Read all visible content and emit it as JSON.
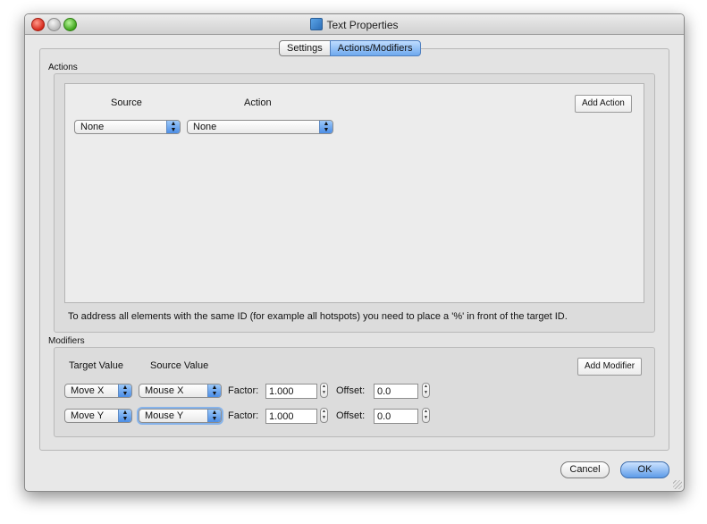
{
  "window": {
    "title": "Text Properties",
    "title_icon": "text-properties-app-icon"
  },
  "tabs": [
    {
      "label": "Settings",
      "active": false
    },
    {
      "label": "Actions/Modifiers",
      "active": true
    }
  ],
  "actions": {
    "group_label": "Actions",
    "source_header": "Source",
    "action_header": "Action",
    "add_button": "Add Action",
    "row": {
      "source": "None",
      "action": "None"
    },
    "hint": "To address all elements with the same ID (for example all hotspots) you need to place a '%' in front of the target ID."
  },
  "modifiers": {
    "group_label": "Modifiers",
    "target_header": "Target Value",
    "source_header": "Source Value",
    "add_button": "Add Modifier",
    "factor_label": "Factor:",
    "offset_label": "Offset:",
    "rows": [
      {
        "target": "Move X",
        "source": "Mouse X",
        "factor": "1.000",
        "offset": "0.0"
      },
      {
        "target": "Move Y",
        "source": "Mouse Y",
        "factor": "1.000",
        "offset": "0.0"
      }
    ]
  },
  "footer": {
    "cancel": "Cancel",
    "ok": "OK"
  },
  "colors": {
    "accent": "#5c9be8",
    "close": "#d6281b",
    "zoom": "#3fa51c"
  }
}
